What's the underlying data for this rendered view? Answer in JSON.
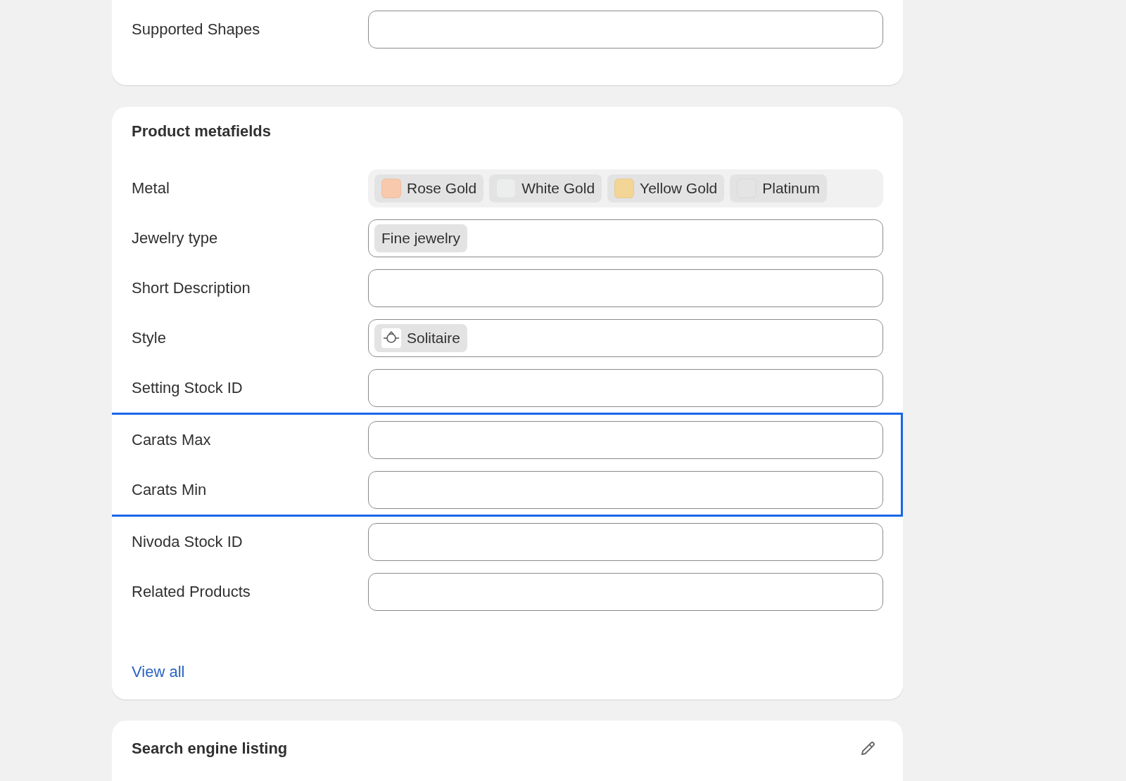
{
  "top_card": {
    "fields": [
      {
        "label": "Supported Shapes",
        "kind": "text"
      }
    ]
  },
  "metafields": {
    "title": "Product metafields",
    "fields": [
      {
        "label": "Metal",
        "kind": "swatches",
        "highlighted": false,
        "chips": [
          {
            "label": "Rose Gold",
            "color": "#f9c9ad"
          },
          {
            "label": "White Gold",
            "color": "#eceeee"
          },
          {
            "label": "Yellow Gold",
            "color": "#f3d596"
          },
          {
            "label": "Platinum",
            "color": "#e4e4e4"
          }
        ]
      },
      {
        "label": "Jewelry type",
        "kind": "tags",
        "highlighted": false,
        "chips": [
          {
            "label": "Fine jewelry"
          }
        ]
      },
      {
        "label": "Short Description",
        "kind": "text",
        "highlighted": false
      },
      {
        "label": "Style",
        "kind": "icon_tags",
        "highlighted": false,
        "chips": [
          {
            "label": "Solitaire"
          }
        ]
      },
      {
        "label": "Setting Stock ID",
        "kind": "text",
        "highlighted": false
      },
      {
        "label": "Carats Max",
        "kind": "text",
        "highlighted": true
      },
      {
        "label": "Carats Min",
        "kind": "text",
        "highlighted": true
      },
      {
        "label": "Nivoda Stock ID",
        "kind": "text",
        "highlighted": false
      },
      {
        "label": "Related Products",
        "kind": "text",
        "highlighted": false
      }
    ],
    "link": "View all"
  },
  "seo": {
    "title": "Search engine listing"
  }
}
